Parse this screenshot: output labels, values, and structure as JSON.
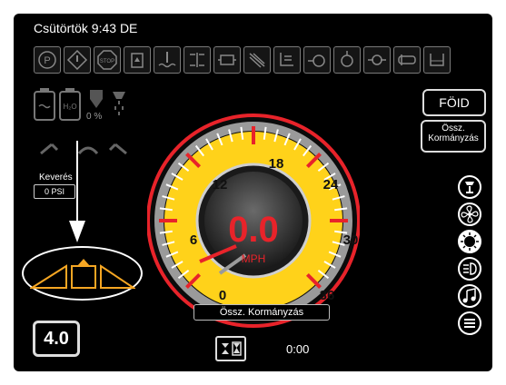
{
  "header": {
    "datetime": "Csütörtök 9:43 DE"
  },
  "status_icons": [
    "parking-brake-icon",
    "warning-icon",
    "stop-icon",
    "fuel-filter-icon",
    "coolant-temp-icon",
    "transmission-icon",
    "engine-fan-icon",
    "hydraulic-icon",
    "oil-level-icon",
    "engine-preheat-icon",
    "oil-pressure-icon",
    "air-filter-icon",
    "hydraulic-filter-icon",
    "blank-indicator-icon"
  ],
  "left_panel": {
    "water_percent": "0 %",
    "mixing_label": "Keverés",
    "pressure_value": "0 PSI",
    "speed_setting": "4.0"
  },
  "buttons": {
    "ground_label": "FÖID",
    "steering_line1": "Össz.",
    "steering_line2": "Kormányzás"
  },
  "gauge": {
    "speed_value": "0.0",
    "unit": "MPH",
    "ticks": [
      "0",
      "6",
      "12",
      "18",
      "24",
      "30",
      "36"
    ],
    "mode_label": "Össz. Kormányzás",
    "timer": "0:00",
    "accent_color": "#ffd21a",
    "redline_color": "#e8232a"
  },
  "side_icons": [
    "agitator-icon",
    "fan-icon",
    "work-light-icon",
    "headlight-icon",
    "music-icon",
    "menu-icon"
  ]
}
